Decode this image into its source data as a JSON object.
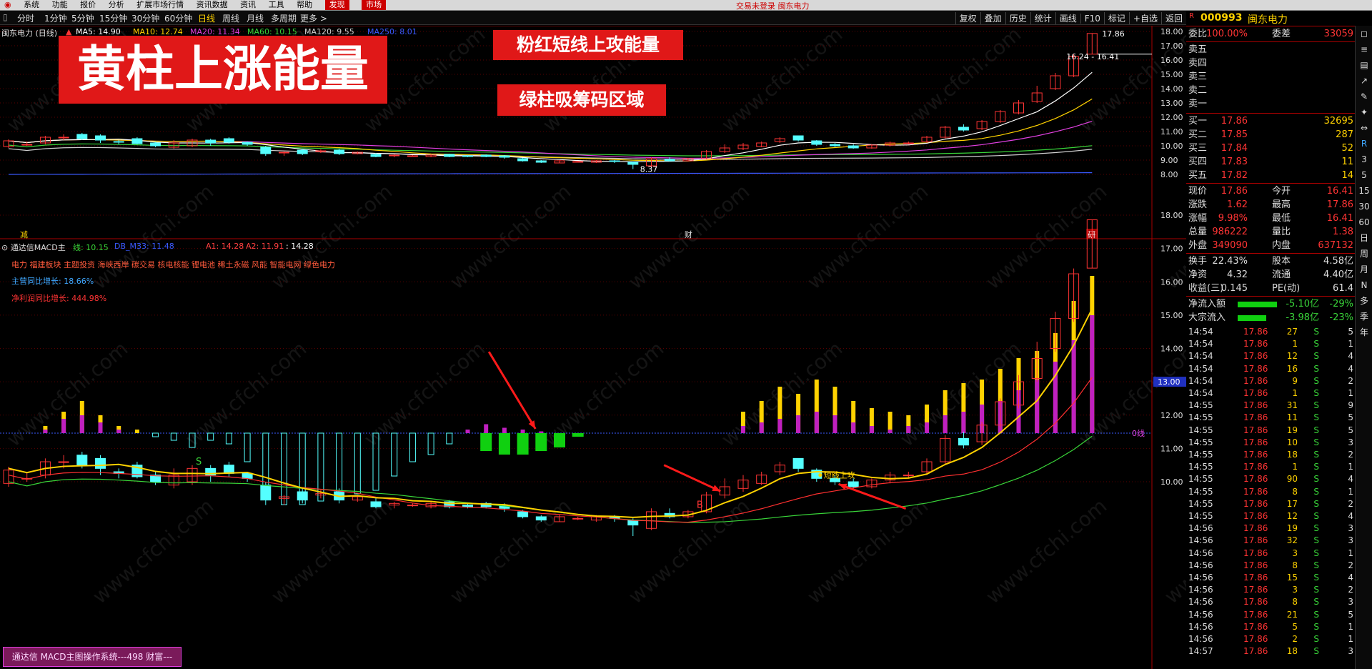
{
  "topbar": {
    "menu": [
      "系统",
      "功能",
      "报价",
      "分析",
      "扩展市场行情",
      "资讯数据",
      "资讯",
      "工具",
      "帮助"
    ],
    "center_text": "交易未登录  闽东电力",
    "right_buttons": [
      "发现",
      "市场"
    ]
  },
  "toolbar": {
    "periods": [
      "分时",
      "1分钟",
      "5分钟",
      "15分钟",
      "30分钟",
      "60分钟",
      "日线",
      "周线",
      "月线",
      "多周期",
      "更多 >"
    ],
    "active_period": "日线",
    "right_buttons": [
      "复权",
      "叠加",
      "历史",
      "统计",
      "画线",
      "F10",
      "标记",
      "+自选",
      "返回"
    ]
  },
  "stock": {
    "code": "000993",
    "name": "闽东电力"
  },
  "upper_chart": {
    "title": "闽东电力 (日线)",
    "ma_legend": [
      {
        "label": "MA5: 14.90",
        "color": "#ffffff"
      },
      {
        "label": "MA10: 12.74",
        "color": "#ffd200"
      },
      {
        "label": "MA20: 11.34",
        "color": "#e040e0"
      },
      {
        "label": "MA60: 10.15",
        "color": "#39d439"
      },
      {
        "label": "MA120: 9.55",
        "color": "#cfcfcf"
      },
      {
        "label": "MA250: 8.01",
        "color": "#3a5aff"
      }
    ],
    "y_ticks": [
      "18.00",
      "17.00",
      "16.00",
      "15.00",
      "14.00",
      "13.00",
      "12.00",
      "11.00",
      "10.00",
      "9.00",
      "8.00"
    ],
    "high_label": "17.86",
    "range_label": "16.24 - 16.41",
    "low_label": "8.37",
    "markers": {
      "left": "减",
      "mid": "财",
      "right": "研"
    }
  },
  "lower_chart": {
    "title": "通达信MACD主",
    "legend": [
      {
        "label": "线: 10.15",
        "color": "#39d439"
      },
      {
        "label": "DB_M33: 11.48",
        "color": "#3a5aff"
      },
      {
        "label": "A1: 14.28",
        "color": "#ff4040"
      },
      {
        "label": "A2: 11.91",
        "color": "#ff4040"
      },
      {
        "label": ": 14.28",
        "color": "#ffffff"
      }
    ],
    "concepts": "电力 福建板块 主题投资 海峡西岸 碳交易 核电核能 锂电池 稀土永磁 风能 智能电网 绿色电力",
    "revenue_growth": "主营同比增长: 18.66%",
    "profit_growth": "净利润同比增长: 444.98%",
    "y_ticks": [
      "18.00",
      "17.00",
      "16.00",
      "15.00",
      "14.00",
      "13.00",
      "12.00",
      "11.00",
      "10.00"
    ],
    "current_price_tag": "13.00",
    "zero_line_label": "0线",
    "signal_label": "短线上攻",
    "buy_mark": "B",
    "sell_mark": "S"
  },
  "banners": {
    "yellow_bar": "黄柱上涨能量",
    "pink_bar": "粉红短线上攻能量",
    "green_bar": "绿柱吸筹码区域"
  },
  "footer_tag": "通达信 MACD主图操作系统---498 财富---",
  "watermark": "www.cfchi.com",
  "quote": {
    "ratio": {
      "label": "委比",
      "value": "100.00%",
      "label2": "委差",
      "value2": "33059"
    },
    "sell": [
      {
        "label": "卖五",
        "price": "",
        "vol": ""
      },
      {
        "label": "卖四",
        "price": "",
        "vol": ""
      },
      {
        "label": "卖三",
        "price": "",
        "vol": ""
      },
      {
        "label": "卖二",
        "price": "",
        "vol": ""
      },
      {
        "label": "卖一",
        "price": "",
        "vol": ""
      }
    ],
    "buy": [
      {
        "label": "买一",
        "price": "17.86",
        "vol": "32695"
      },
      {
        "label": "买二",
        "price": "17.85",
        "vol": "287"
      },
      {
        "label": "买三",
        "price": "17.84",
        "vol": "52"
      },
      {
        "label": "买四",
        "price": "17.83",
        "vol": "11"
      },
      {
        "label": "买五",
        "price": "17.82",
        "vol": "14"
      }
    ],
    "stats": [
      {
        "l1": "现价",
        "v1": "17.86",
        "l2": "今开",
        "v2": "16.41"
      },
      {
        "l1": "涨跌",
        "v1": "1.62",
        "l2": "最高",
        "v2": "17.86"
      },
      {
        "l1": "涨幅",
        "v1": "9.98%",
        "l2": "最低",
        "v2": "16.41"
      },
      {
        "l1": "总量",
        "v1": "986222",
        "l2": "量比",
        "v2": "1.38"
      },
      {
        "l1": "外盘",
        "v1": "349090",
        "l2": "内盘",
        "v2": "637132"
      }
    ],
    "stats2": [
      {
        "l1": "换手",
        "v1": "22.43%",
        "l2": "股本",
        "v2": "4.58亿"
      },
      {
        "l1": "净资",
        "v1": "4.32",
        "l2": "流通",
        "v2": "4.40亿"
      },
      {
        "l1": "收益(三)",
        "v1": "0.145",
        "l2": "PE(动)",
        "v2": "61.4"
      }
    ],
    "flows": [
      {
        "label": "净流入额",
        "value": "-5.10亿",
        "pct": "-29%",
        "fill": 0.55
      },
      {
        "label": "大宗流入",
        "value": "-3.98亿",
        "pct": "-23%",
        "fill": 0.4
      }
    ],
    "trades": [
      {
        "time": "14:54",
        "price": "17.86",
        "vol": "27",
        "bs": "S",
        "n": "5"
      },
      {
        "time": "14:54",
        "price": "17.86",
        "vol": "1",
        "bs": "S",
        "n": "1"
      },
      {
        "time": "14:54",
        "price": "17.86",
        "vol": "12",
        "bs": "S",
        "n": "4"
      },
      {
        "time": "14:54",
        "price": "17.86",
        "vol": "16",
        "bs": "S",
        "n": "4"
      },
      {
        "time": "14:54",
        "price": "17.86",
        "vol": "9",
        "bs": "S",
        "n": "2"
      },
      {
        "time": "14:54",
        "price": "17.86",
        "vol": "1",
        "bs": "S",
        "n": "1"
      },
      {
        "time": "14:55",
        "price": "17.86",
        "vol": "31",
        "bs": "S",
        "n": "9"
      },
      {
        "time": "14:55",
        "price": "17.86",
        "vol": "11",
        "bs": "S",
        "n": "5"
      },
      {
        "time": "14:55",
        "price": "17.86",
        "vol": "19",
        "bs": "S",
        "n": "5"
      },
      {
        "time": "14:55",
        "price": "17.86",
        "vol": "10",
        "bs": "S",
        "n": "3"
      },
      {
        "time": "14:55",
        "price": "17.86",
        "vol": "18",
        "bs": "S",
        "n": "2"
      },
      {
        "time": "14:55",
        "price": "17.86",
        "vol": "1",
        "bs": "S",
        "n": "1"
      },
      {
        "time": "14:55",
        "price": "17.86",
        "vol": "90",
        "bs": "S",
        "n": "4"
      },
      {
        "time": "14:55",
        "price": "17.86",
        "vol": "8",
        "bs": "S",
        "n": "1"
      },
      {
        "time": "14:55",
        "price": "17.86",
        "vol": "17",
        "bs": "S",
        "n": "2"
      },
      {
        "time": "14:55",
        "price": "17.86",
        "vol": "12",
        "bs": "S",
        "n": "4"
      },
      {
        "time": "14:56",
        "price": "17.86",
        "vol": "19",
        "bs": "S",
        "n": "3"
      },
      {
        "time": "14:56",
        "price": "17.86",
        "vol": "32",
        "bs": "S",
        "n": "3"
      },
      {
        "time": "14:56",
        "price": "17.86",
        "vol": "3",
        "bs": "S",
        "n": "1"
      },
      {
        "time": "14:56",
        "price": "17.86",
        "vol": "8",
        "bs": "S",
        "n": "2"
      },
      {
        "time": "14:56",
        "price": "17.86",
        "vol": "15",
        "bs": "S",
        "n": "4"
      },
      {
        "time": "14:56",
        "price": "17.86",
        "vol": "3",
        "bs": "S",
        "n": "2"
      },
      {
        "time": "14:56",
        "price": "17.86",
        "vol": "8",
        "bs": "S",
        "n": "3"
      },
      {
        "time": "14:56",
        "price": "17.86",
        "vol": "21",
        "bs": "S",
        "n": "5"
      },
      {
        "time": "14:56",
        "price": "17.86",
        "vol": "5",
        "bs": "S",
        "n": "1"
      },
      {
        "time": "14:56",
        "price": "17.86",
        "vol": "2",
        "bs": "S",
        "n": "1"
      },
      {
        "time": "14:57",
        "price": "17.86",
        "vol": "18",
        "bs": "S",
        "n": "3"
      }
    ]
  },
  "sidebar": [
    "R",
    "3",
    "5",
    "15",
    "30",
    "60",
    "日",
    "周",
    "月",
    "N",
    "多",
    "季",
    "年"
  ],
  "candles": [
    [
      9.95,
      10.35,
      9.85,
      10.45
    ],
    [
      10.1,
      10.1,
      10,
      10.3
    ],
    [
      10.2,
      10.6,
      10.1,
      10.7
    ],
    [
      10.6,
      10.6,
      10.4,
      10.8
    ],
    [
      10.8,
      10.5,
      10.4,
      10.9
    ],
    [
      10.7,
      10.4,
      10.2,
      10.8
    ],
    [
      10.3,
      10.25,
      10.1,
      10.4
    ],
    [
      10.5,
      10.15,
      10.1,
      10.6
    ],
    [
      10.2,
      10,
      9.9,
      10.3
    ],
    [
      9.9,
      10.2,
      9.8,
      10.4
    ],
    [
      10.0,
      10.4,
      9.9,
      10.5
    ],
    [
      10.4,
      10.2,
      10.0,
      10.5
    ],
    [
      10.5,
      10.25,
      10.15,
      10.6
    ],
    [
      10.25,
      10.1,
      10.0,
      10.3
    ],
    [
      9.9,
      9.45,
      9.3,
      10.0
    ],
    [
      9.5,
      9.55,
      9.3,
      9.6
    ],
    [
      9.7,
      9.45,
      9.35,
      9.8
    ],
    [
      9.6,
      9.65,
      9.5,
      9.75
    ],
    [
      9.7,
      9.45,
      9.35,
      9.8
    ],
    [
      9.45,
      9.55,
      9.4,
      9.6
    ],
    [
      9.4,
      9.25,
      9.2,
      9.5
    ],
    [
      9.3,
      9.35,
      9.2,
      9.4
    ],
    [
      9.3,
      9.3,
      9.25,
      9.35
    ],
    [
      9.25,
      9.35,
      9.2,
      9.4
    ],
    [
      9.4,
      9.25,
      9.2,
      9.45
    ],
    [
      9.3,
      9.25,
      9.2,
      9.35
    ],
    [
      9.35,
      9.25,
      9.2,
      9.4
    ],
    [
      9.3,
      9.2,
      9.1,
      9.35
    ],
    [
      9.1,
      8.95,
      8.9,
      9.15
    ],
    [
      8.95,
      8.85,
      8.8,
      9.0
    ],
    [
      8.8,
      8.95,
      8.8,
      9.0
    ],
    [
      8.9,
      8.9,
      8.85,
      8.95
    ],
    [
      8.85,
      8.95,
      8.8,
      9.0
    ],
    [
      8.95,
      8.9,
      8.8,
      9.0
    ],
    [
      8.85,
      8.7,
      8.37,
      8.9
    ],
    [
      8.6,
      9.1,
      8.55,
      9.2
    ],
    [
      9.05,
      8.95,
      8.9,
      9.2
    ],
    [
      8.95,
      9.1,
      8.9,
      9.15
    ],
    [
      9.1,
      9.6,
      9.05,
      9.7
    ],
    [
      9.6,
      9.85,
      9.5,
      10.1
    ],
    [
      9.8,
      10.05,
      9.7,
      10.2
    ],
    [
      9.95,
      10.2,
      9.9,
      10.3
    ],
    [
      10.3,
      10.5,
      10.2,
      10.6
    ],
    [
      10.7,
      10.4,
      10.3,
      10.7
    ],
    [
      10.35,
      10.1,
      10.0,
      10.4
    ],
    [
      10.1,
      10.0,
      9.9,
      10.2
    ],
    [
      10.0,
      9.85,
      9.8,
      10.1
    ],
    [
      9.85,
      10.05,
      9.8,
      10.1
    ],
    [
      10.05,
      10.2,
      9.95,
      10.3
    ],
    [
      10.2,
      10.2,
      10.1,
      10.3
    ],
    [
      10.3,
      10.6,
      10.2,
      10.7
    ],
    [
      10.6,
      11.3,
      10.5,
      11.4
    ],
    [
      11.3,
      11.1,
      11.0,
      11.5
    ],
    [
      11.2,
      11.7,
      11.1,
      11.8
    ],
    [
      11.7,
      12.4,
      11.6,
      12.5
    ],
    [
      12.3,
      13.0,
      12.2,
      13.2
    ],
    [
      13.1,
      13.7,
      13.0,
      14.2
    ],
    [
      14.0,
      14.9,
      13.9,
      15.1
    ],
    [
      14.9,
      16.24,
      14.8,
      16.4
    ],
    [
      16.41,
      17.86,
      16.41,
      17.86
    ]
  ],
  "energy": [
    [
      0,
      0,
      0
    ],
    [
      0,
      0,
      0
    ],
    [
      0.2,
      0.1,
      0
    ],
    [
      0.6,
      0.4,
      0
    ],
    [
      0.9,
      0.5,
      0
    ],
    [
      0.5,
      0.3,
      0
    ],
    [
      0.2,
      0.1,
      0
    ],
    [
      0.1,
      0,
      0
    ],
    [
      0,
      0,
      0.05
    ],
    [
      0,
      0,
      0.1
    ],
    [
      0,
      0,
      0.2
    ],
    [
      0,
      0,
      0.1
    ],
    [
      0,
      0,
      0.15
    ],
    [
      0,
      0,
      0.4
    ],
    [
      0,
      0,
      0.9
    ],
    [
      0,
      0,
      1.0
    ],
    [
      0,
      0,
      1.0
    ],
    [
      0,
      0,
      0.95
    ],
    [
      0,
      0,
      0.9
    ],
    [
      0,
      0,
      0.85
    ],
    [
      0,
      0,
      0.8
    ],
    [
      0,
      0,
      0.6
    ],
    [
      0,
      0,
      0.4
    ],
    [
      0,
      0,
      0.3
    ],
    [
      0,
      0,
      0.15
    ],
    [
      0,
      0.1,
      0
    ],
    [
      0,
      0.25,
      0
    ],
    [
      0,
      0.15,
      0
    ],
    [
      0,
      0.1,
      0
    ],
    [
      0,
      0.05,
      0
    ],
    [
      0,
      0,
      0
    ],
    [
      0,
      0,
      0
    ],
    [
      0,
      0,
      0
    ],
    [
      0,
      0,
      0
    ],
    [
      0,
      0,
      0
    ],
    [
      0,
      0,
      0
    ],
    [
      0,
      0,
      0
    ],
    [
      0,
      0,
      0
    ],
    [
      0,
      0,
      0
    ],
    [
      0,
      0,
      0
    ],
    [
      0.6,
      0.2,
      0
    ],
    [
      0.9,
      0.3,
      0
    ],
    [
      1.3,
      0.4,
      0
    ],
    [
      1.1,
      0.5,
      0
    ],
    [
      1.5,
      0.6,
      0
    ],
    [
      1.3,
      0.5,
      0
    ],
    [
      0.9,
      0.3,
      0
    ],
    [
      0.7,
      0.2,
      0
    ],
    [
      0.6,
      0.1,
      0
    ],
    [
      0.5,
      0.2,
      0
    ],
    [
      0.8,
      0.3,
      0
    ],
    [
      1.2,
      0.5,
      0
    ],
    [
      1.4,
      0.6,
      0
    ],
    [
      1.5,
      0.8,
      0
    ],
    [
      1.8,
      0.9,
      0
    ],
    [
      2.1,
      1.2,
      0
    ],
    [
      2.3,
      1.5,
      0
    ],
    [
      2.8,
      2.0,
      0
    ],
    [
      3.7,
      2.6,
      0
    ],
    [
      4.4,
      3.3,
      0
    ]
  ],
  "green_bars": [
    0.25,
    0.3,
    0.3,
    0.25,
    0.2,
    0.05
  ]
}
